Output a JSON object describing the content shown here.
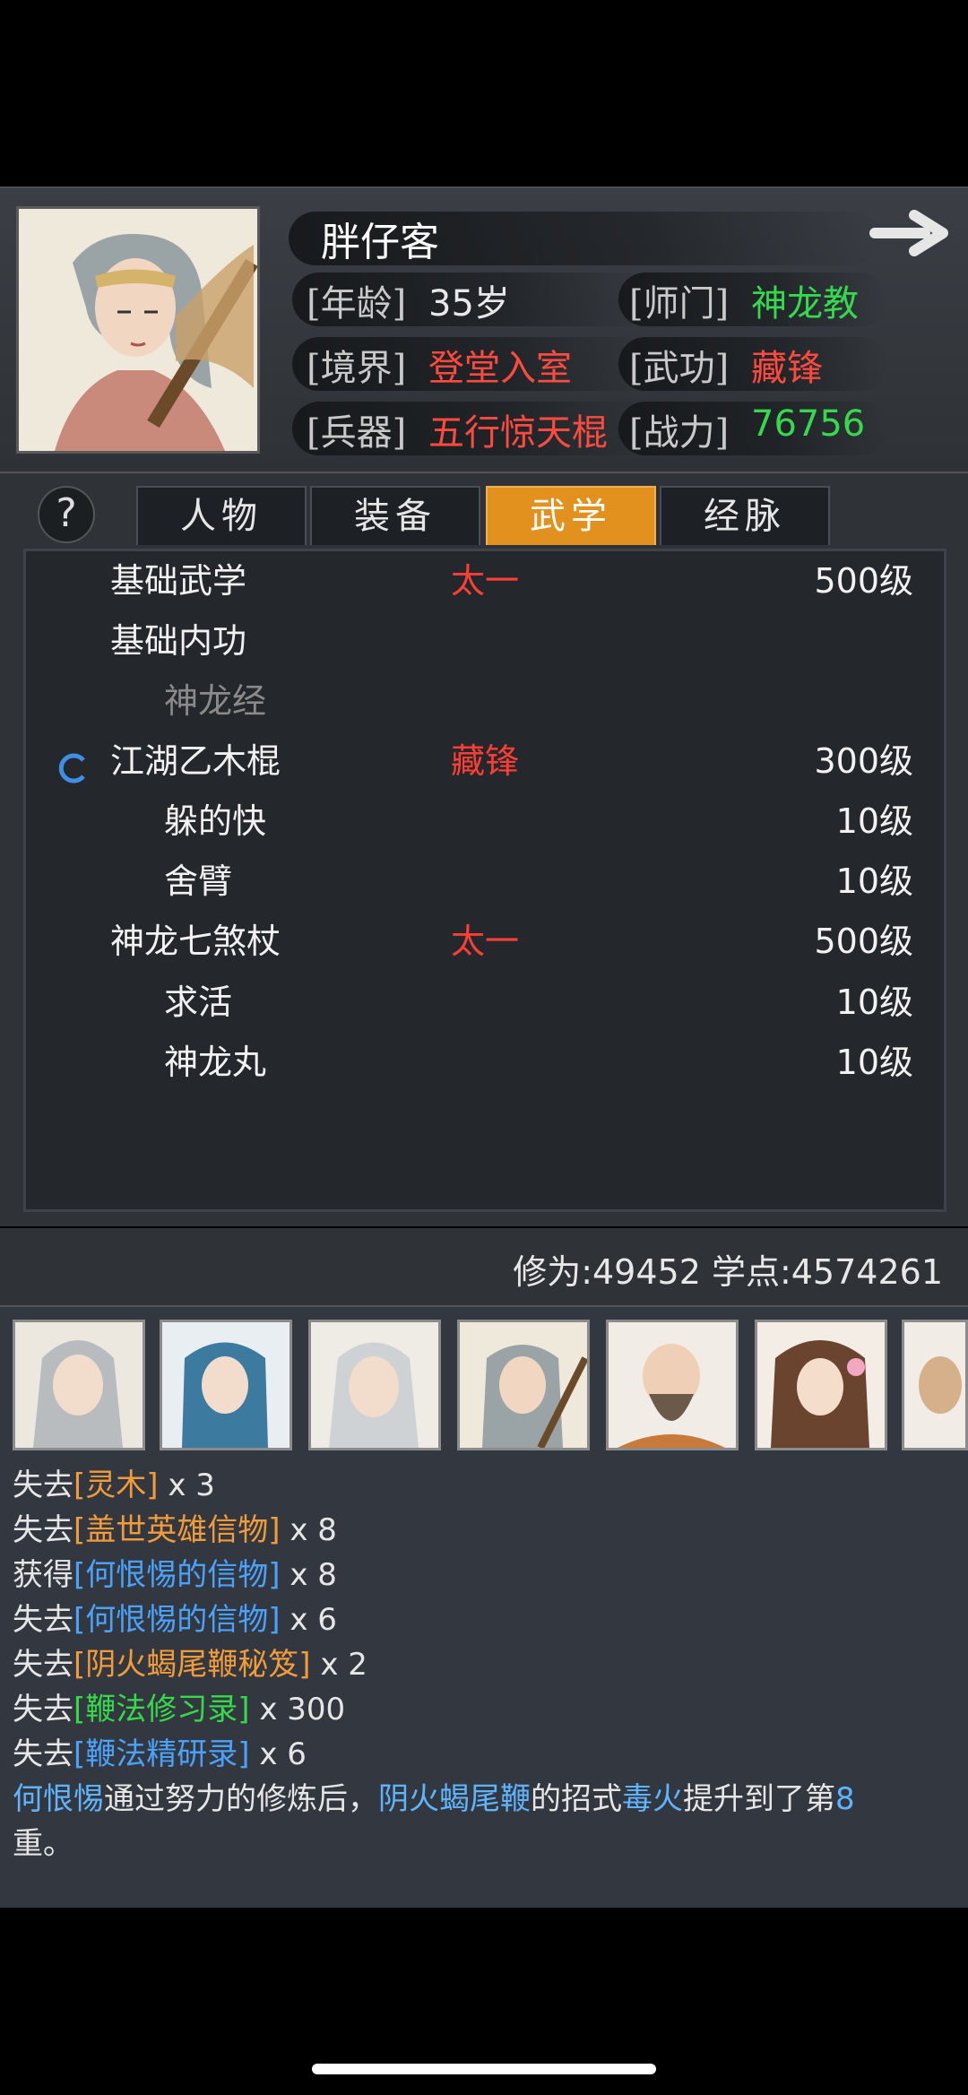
{
  "header": {
    "name": "胖仔客",
    "rows": [
      {
        "l1": "[年龄]",
        "v1": "35岁",
        "l2": "[师门]",
        "v2": "神龙教"
      },
      {
        "l1": "[境界]",
        "v1": "登堂入室",
        "l2": "[武功]",
        "v2": "藏锋"
      },
      {
        "l1": "[兵器]",
        "v1": "五行惊天棍",
        "l2": "[战力]",
        "v2": "76756"
      }
    ]
  },
  "tabs": [
    "人物",
    "装备",
    "武学",
    "经脉"
  ],
  "help_label": "?",
  "skills": [
    {
      "name": "基础武学",
      "tag": "太一",
      "level": "500级"
    },
    {
      "name": "基础内功",
      "tag": "",
      "level": ""
    },
    {
      "name": "神龙经",
      "tag": "",
      "level": ""
    },
    {
      "name": "江湖乙木棍",
      "tag": "藏锋",
      "level": "300级"
    },
    {
      "name": "躲的快",
      "tag": "",
      "level": "10级"
    },
    {
      "name": "舍臂",
      "tag": "",
      "level": "10级"
    },
    {
      "name": "神龙七煞杖",
      "tag": "太一",
      "level": "500级"
    },
    {
      "name": "求活",
      "tag": "",
      "level": "10级"
    },
    {
      "name": "神龙丸",
      "tag": "",
      "level": "10级"
    }
  ],
  "stats": "修为:49452  学点:4574261",
  "log": {
    "l1a": "失去",
    "l1b": "[灵木]",
    "l1c": " x 3",
    "l2a": "失去",
    "l2b": "[盖世英雄信物]",
    "l2c": " x 8",
    "l3a": "获得",
    "l3b": "[何恨惕的信物]",
    "l3c": " x 8",
    "l4a": "失去",
    "l4b": "[何恨惕的信物]",
    "l4c": " x 6",
    "l5a": "失去",
    "l5b": "[阴火蝎尾鞭秘笈]",
    "l5c": " x 2",
    "l6a": "失去",
    "l6b": "[鞭法修习录]",
    "l6c": " x 300",
    "l7a": "失去",
    "l7b": "[鞭法精研录]",
    "l7c": " x 6",
    "l8a": "何恨惕",
    "l8b": "通过努力的修炼后，",
    "l8c": "阴火蝎尾鞭",
    "l8d": "的招式",
    "l8e": "毒火",
    "l8f": "提升到了第",
    "l8g": "8",
    "l9": "重。"
  }
}
